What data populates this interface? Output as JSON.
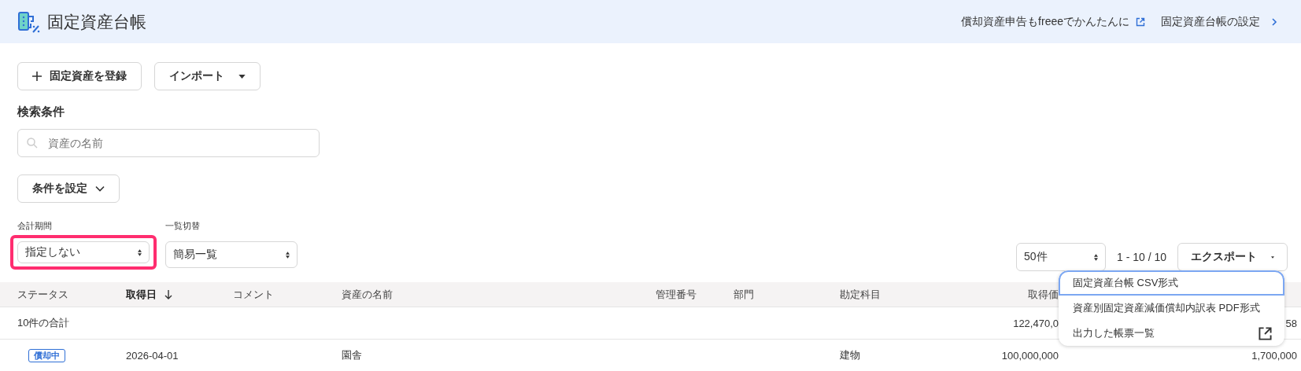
{
  "header": {
    "title": "固定資産台帳",
    "links": [
      {
        "label": "償却資産申告もfreeeでかんたんに",
        "kind": "external"
      },
      {
        "label": "固定資産台帳の設定",
        "kind": "chevron"
      }
    ]
  },
  "actions": [
    {
      "label": "固定資産を登録",
      "kind": "plus"
    },
    {
      "label": "インポート",
      "kind": "caret"
    }
  ],
  "search": {
    "heading": "検索条件",
    "placeholder": "資産の名前",
    "conditions_button": "条件を設定"
  },
  "filters": [
    {
      "label": "会計期間",
      "value": "指定しない",
      "highlighted": true
    },
    {
      "label": "一覧切替",
      "value": "簡易一覧",
      "highlighted": false
    }
  ],
  "pager": {
    "per_page": "50件",
    "range": "1 - 10 / 10",
    "export_button": "エクスポート"
  },
  "export_menu": [
    {
      "label": "固定資産台帳 CSV形式",
      "selected": true,
      "kind": "plain"
    },
    {
      "label": "資産別固定資産減価償却内訳表 PDF形式",
      "selected": false,
      "kind": "plain"
    },
    {
      "label": "出力した帳票一覧",
      "selected": false,
      "kind": "external"
    }
  ],
  "table": {
    "columns": [
      {
        "label": "ステータス",
        "sorted": false
      },
      {
        "label": "取得日",
        "sorted": true
      },
      {
        "label": "コメント",
        "sorted": false
      },
      {
        "label": "資産の名前",
        "sorted": false
      },
      {
        "label": "管理番号",
        "sorted": false
      },
      {
        "label": "部門",
        "sorted": false
      },
      {
        "label": "勘定科目",
        "sorted": false
      },
      {
        "label": "取得価",
        "sorted": false
      }
    ],
    "total_row": {
      "label": "10件の合計",
      "column_8": "122,470,0",
      "column_10": "58"
    },
    "rows": [
      {
        "status": "償却中",
        "date": "2026-04-01",
        "name": "園舎",
        "account": "建物",
        "column_8": "100,000,000",
        "column_10": "1,700,000"
      }
    ]
  }
}
